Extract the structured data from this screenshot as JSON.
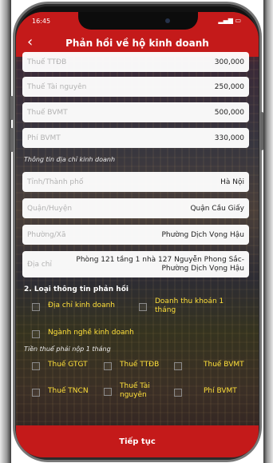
{
  "status_bar": {
    "time": "16:45",
    "indicators": "all"
  },
  "header": {
    "back_icon": "chevron-left-icon",
    "title": "Phản hồi về hộ kinh doanh"
  },
  "tax_fields": [
    {
      "placeholder": "Thuế TTĐB",
      "value": "300,000"
    },
    {
      "placeholder": "Thuế Tài nguyên",
      "value": "250,000"
    },
    {
      "placeholder": "Thuế BVMT",
      "value": "500,000"
    },
    {
      "placeholder": "Phí BVMT",
      "value": "330,000"
    }
  ],
  "address_section": {
    "label": "Thông tin địa chỉ kinh doanh",
    "fields": [
      {
        "placeholder": "Tỉnh/Thành phố",
        "value": "Hà Nội"
      },
      {
        "placeholder": "Quận/Huyện",
        "value": "Quận Cầu Giấy"
      },
      {
        "placeholder": "Phường/Xã",
        "value": "Phường Dịch Vọng Hậu"
      },
      {
        "placeholder": "Địa chỉ",
        "value": "Phòng 121 tầng 1 nhà 127 Nguyễn Phong Sắc- Phường Dịch Vọng Hậu"
      }
    ]
  },
  "feedback_section": {
    "title": "2. Loại thông tin phản hồi",
    "options": [
      {
        "label": "Địa chỉ kinh doanh",
        "checked": false
      },
      {
        "label": "Doanh thu khoán 1 tháng",
        "checked": false
      },
      {
        "label": "Ngành nghề kinh doanh",
        "checked": false
      }
    ]
  },
  "tax_section": {
    "label": "Tiền thuế phải nộp 1 tháng",
    "options": [
      {
        "label": "Thuế GTGT",
        "checked": false
      },
      {
        "label": "Thuế TTĐB",
        "checked": false
      },
      {
        "label": "Thuế BVMT",
        "checked": false
      },
      {
        "label": "Thuế TNCN",
        "checked": false
      },
      {
        "label": "Thuế Tài nguyên",
        "checked": false
      },
      {
        "label": "Phí BVMT",
        "checked": false
      }
    ]
  },
  "footer": {
    "continue_label": "Tiếp tục"
  },
  "colors": {
    "brand_red": "#c41a1a",
    "option_yellow": "#ffe03a"
  }
}
